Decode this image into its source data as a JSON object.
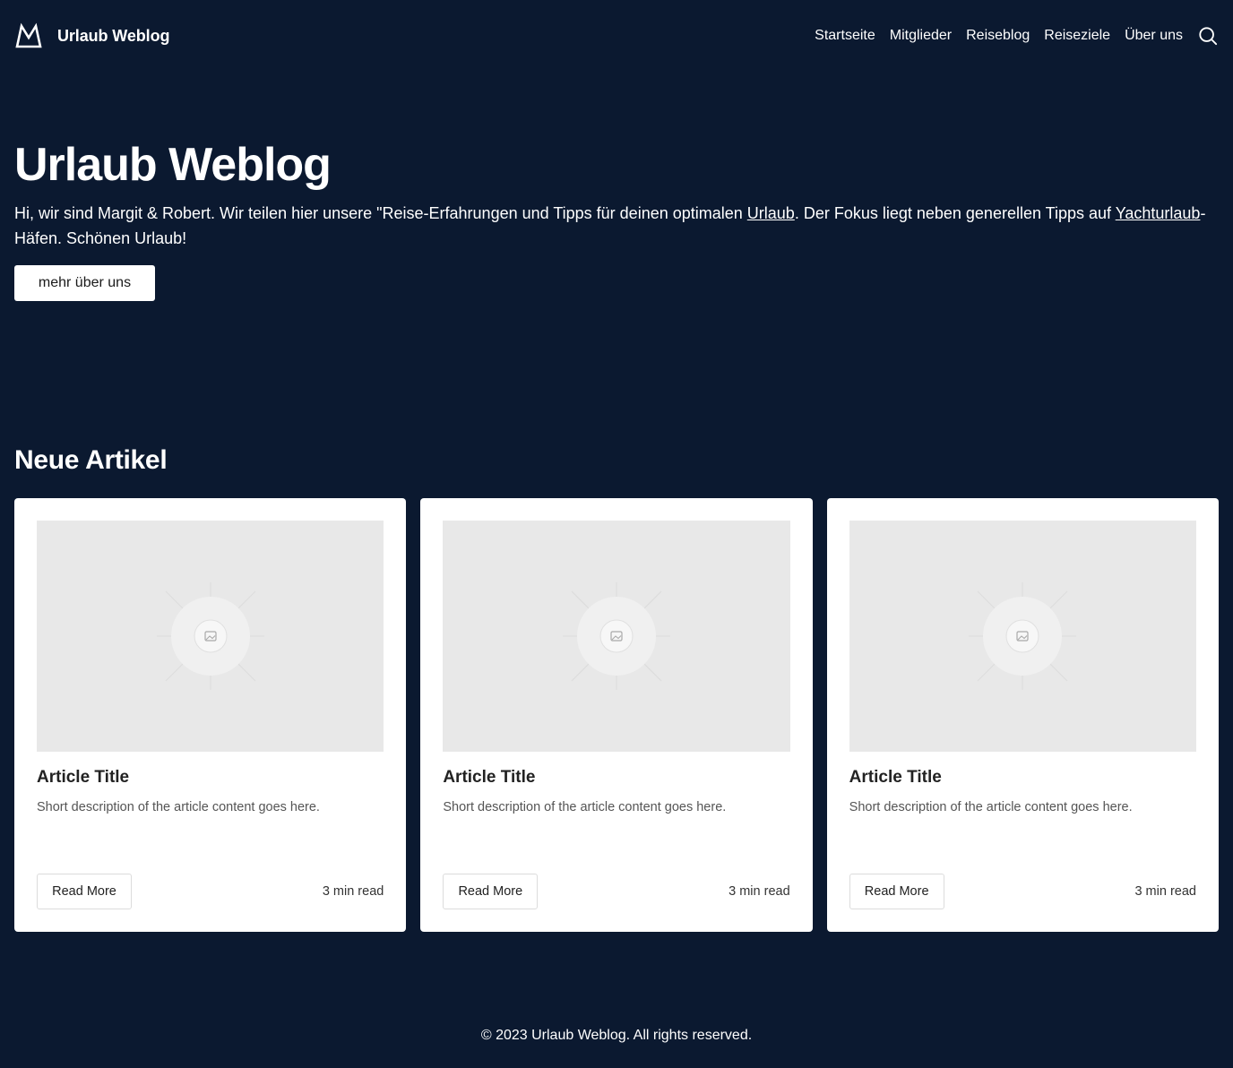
{
  "header": {
    "brand_name": "Urlaub Weblog",
    "logo_icon": "mountain-logo-icon",
    "nav": [
      {
        "label": "Startseite"
      },
      {
        "label": "Mitglieder"
      },
      {
        "label": "Reiseblog"
      },
      {
        "label": "Reiseziele"
      },
      {
        "label": "Über uns"
      }
    ],
    "search_icon": "search-icon"
  },
  "hero": {
    "title": "Urlaub Weblog",
    "text_part1": "Hi, wir sind Margit & Robert. Wir teilen hier unsere \"Reise-Erfahrungen und Tipps für deinen optimalen ",
    "link1": "Urlaub",
    "text_part2": ". Der Fokus liegt neben generellen Tipps auf ",
    "link2": "Yachturlaub",
    "text_part3": "-Häfen. Schönen Urlaub!",
    "button_label": "mehr über uns"
  },
  "articles": {
    "title": "Neue Artikel",
    "items": [
      {
        "title": "Article Title",
        "description": "Short description of the article content goes here.",
        "button_label": "Read More",
        "meta": "3 min read",
        "image_icon": "image-placeholder-icon"
      },
      {
        "title": "Article Title",
        "description": "Short description of the article content goes here.",
        "button_label": "Read More",
        "meta": "3 min read",
        "image_icon": "image-placeholder-icon"
      },
      {
        "title": "Article Title",
        "description": "Short description of the article content goes here.",
        "button_label": "Read More",
        "meta": "3 min read",
        "image_icon": "image-placeholder-icon"
      }
    ]
  },
  "footer": {
    "text": "© 2023 Urlaub Weblog. All rights reserved."
  },
  "colors": {
    "background": "#0b1930",
    "card": "#ffffff",
    "image_placeholder": "#e8e8e8"
  }
}
